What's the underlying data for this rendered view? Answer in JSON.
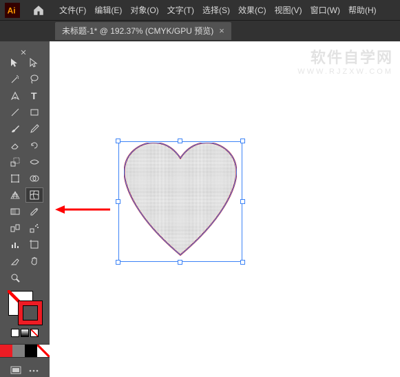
{
  "app": {
    "name": "Ai"
  },
  "menu": {
    "file": "文件(F)",
    "edit": "编辑(E)",
    "object": "对象(O)",
    "type": "文字(T)",
    "select": "选择(S)",
    "effect": "效果(C)",
    "view": "视图(V)",
    "window": "窗口(W)",
    "help": "帮助(H)"
  },
  "tab": {
    "title": "未标题-1* @ 192.37% (CMYK/GPU 预览)",
    "close": "×"
  },
  "watermark": {
    "main": "软件自学网",
    "sub": "WWW.RJZXW.COM"
  },
  "colors": {
    "stroke": "#ed1c24",
    "swatch_red": "#ed1c24",
    "swatch_gray": "#808080",
    "swatch_black": "#000000",
    "swatch_none": "none"
  },
  "tools": {
    "row1": [
      "selection",
      "direct-selection"
    ],
    "row2": [
      "magic-wand",
      "lasso"
    ],
    "row3": [
      "pen",
      "type"
    ],
    "row4": [
      "line",
      "rectangle"
    ],
    "row5": [
      "paintbrush",
      "pencil"
    ],
    "row6": [
      "eraser",
      "rotate"
    ],
    "row7": [
      "scale",
      "width"
    ],
    "row8": [
      "free-transform",
      "shape-builder"
    ],
    "row9": [
      "perspective",
      "mesh"
    ],
    "row10": [
      "gradient",
      "eyedropper"
    ],
    "row11": [
      "blend",
      "symbol-sprayer"
    ],
    "row12": [
      "column-graph",
      "artboard"
    ],
    "row13": [
      "slice",
      "hand"
    ],
    "row14": [
      "zoom",
      ""
    ]
  },
  "highlighted_tool": "mesh"
}
